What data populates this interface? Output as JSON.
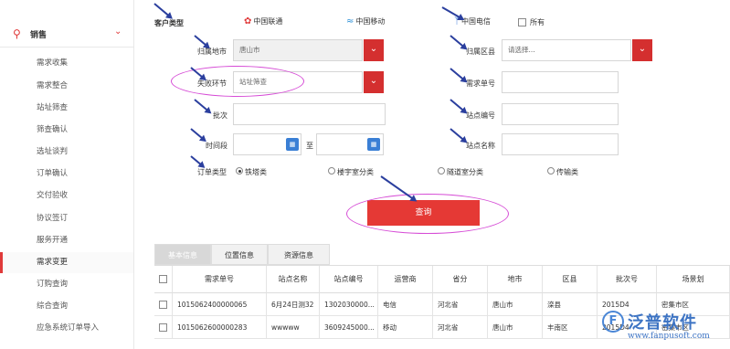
{
  "sidebar": {
    "section_title": "销售",
    "items": [
      {
        "label": "需求收集"
      },
      {
        "label": "需求整合"
      },
      {
        "label": "站址筛查"
      },
      {
        "label": "筛查确认"
      },
      {
        "label": "选址谈判"
      },
      {
        "label": "订单确认"
      },
      {
        "label": "交付验收"
      },
      {
        "label": "协议签订"
      },
      {
        "label": "服务开通"
      },
      {
        "label": "需求变更",
        "active": true
      },
      {
        "label": "订购查询"
      },
      {
        "label": "综合查询"
      },
      {
        "label": "应急系统订单导入"
      }
    ]
  },
  "form": {
    "customer_type_label": "客户类型",
    "carriers": [
      "中国联通",
      "中国移动",
      "中国电信"
    ],
    "all_label": "所有",
    "city_label": "归属地市",
    "city_value": "唐山市",
    "county_label": "归属区县",
    "county_placeholder": "请选择...",
    "fail_label": "失败环节",
    "fail_value": "站址筛查",
    "demand_no_label": "需求单号",
    "batch_label": "批次",
    "site_code_label": "站点编号",
    "time_label": "时间段",
    "to_label": "至",
    "site_name_label": "站点名称",
    "order_type_label": "订单类型",
    "order_types": [
      "铁塔类",
      "楼宇室分类",
      "隧道室分类",
      "传输类"
    ],
    "query_label": "查询"
  },
  "tabs": [
    "基本信息",
    "位置信息",
    "资源信息"
  ],
  "table": {
    "headers": [
      "需求单号",
      "站点名称",
      "站点编号",
      "运营商",
      "省分",
      "地市",
      "区县",
      "批次号",
      "场景划"
    ],
    "rows": [
      [
        "1015062400000065",
        "6月24日测32",
        "1302030000...",
        "电信",
        "河北省",
        "唐山市",
        "滦县",
        "2015D4",
        "密集市区"
      ],
      [
        "1015062600000283",
        "wwwww",
        "3609245000...",
        "移动",
        "河北省",
        "唐山市",
        "丰南区",
        "2015D4",
        "密集市区"
      ]
    ]
  },
  "watermark": {
    "name": "泛普软件",
    "url": "www.fanpusoft.com"
  },
  "colors": {
    "accent": "#e53935",
    "annotation_ellipse": "#d64cd6",
    "annotation_arrow": "#2b3f9e"
  }
}
